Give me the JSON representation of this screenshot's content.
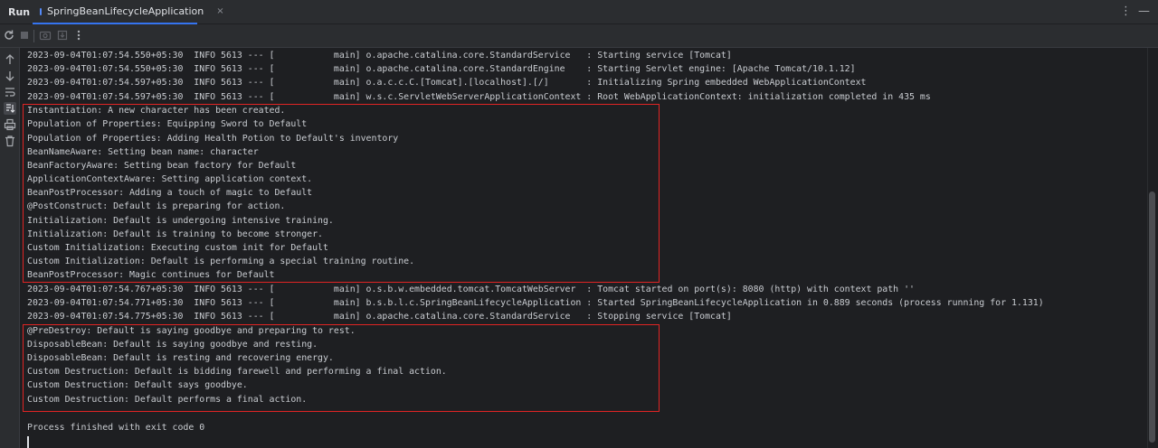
{
  "tool_window": {
    "title": "Run"
  },
  "tab": {
    "label": "SpringBeanLifecycleApplication",
    "close": "×"
  },
  "tabbar_actions": [
    "⋮",
    "—"
  ],
  "toolbar_icons": [
    "rerun-icon",
    "stop-icon",
    "screenshot-icon",
    "export-icon",
    "more-icon"
  ],
  "gutter_icons": [
    "up-arrow-icon",
    "down-arrow-icon",
    "soft-wrap-icon",
    "scroll-to-end-icon",
    "print-icon",
    "trash-icon"
  ],
  "console": {
    "lines": [
      "2023-09-04T01:07:54.550+05:30  INFO 5613 --- [           main] o.apache.catalina.core.StandardService   : Starting service [Tomcat]",
      "2023-09-04T01:07:54.550+05:30  INFO 5613 --- [           main] o.apache.catalina.core.StandardEngine    : Starting Servlet engine: [Apache Tomcat/10.1.12]",
      "2023-09-04T01:07:54.597+05:30  INFO 5613 --- [           main] o.a.c.c.C.[Tomcat].[localhost].[/]       : Initializing Spring embedded WebApplicationContext",
      "2023-09-04T01:07:54.597+05:30  INFO 5613 --- [           main] w.s.c.ServletWebServerApplicationContext : Root WebApplicationContext: initialization completed in 435 ms",
      "Instantiation: A new character has been created.",
      "Population of Properties: Equipping Sword to Default",
      "Population of Properties: Adding Health Potion to Default's inventory",
      "BeanNameAware: Setting bean name: character",
      "BeanFactoryAware: Setting bean factory for Default",
      "ApplicationContextAware: Setting application context.",
      "BeanPostProcessor: Adding a touch of magic to Default",
      "@PostConstruct: Default is preparing for action.",
      "Initialization: Default is undergoing intensive training.",
      "Initialization: Default is training to become stronger.",
      "Custom Initialization: Executing custom init for Default",
      "Custom Initialization: Default is performing a special training routine.",
      "BeanPostProcessor: Magic continues for Default",
      "2023-09-04T01:07:54.767+05:30  INFO 5613 --- [           main] o.s.b.w.embedded.tomcat.TomcatWebServer  : Tomcat started on port(s): 8080 (http) with context path ''",
      "2023-09-04T01:07:54.771+05:30  INFO 5613 --- [           main] b.s.b.l.c.SpringBeanLifecycleApplication : Started SpringBeanLifecycleApplication in 0.889 seconds (process running for 1.131)",
      "2023-09-04T01:07:54.775+05:30  INFO 5613 --- [           main] o.apache.catalina.core.StandardService   : Stopping service [Tomcat]",
      "@PreDestroy: Default is saying goodbye and preparing to rest.",
      "DisposableBean: Default is saying goodbye and resting.",
      "DisposableBean: Default is resting and recovering energy.",
      "Custom Destruction: Default is bidding farewell and performing a final action.",
      "Custom Destruction: Default says goodbye.",
      "Custom Destruction: Default performs a final action.",
      "",
      "Process finished with exit code 0"
    ]
  },
  "colors": {
    "highlight_box": "#e02424",
    "accent": "#3574f0",
    "background": "#1e1f22"
  }
}
